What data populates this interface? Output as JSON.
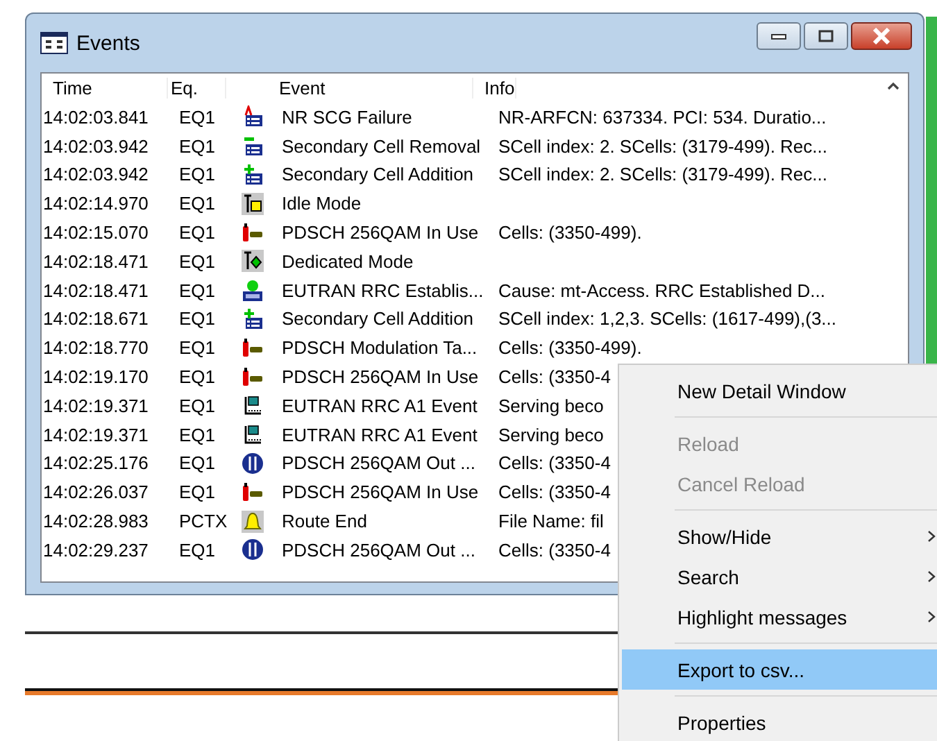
{
  "window": {
    "title": "Events"
  },
  "table": {
    "columns": [
      "Time",
      "Eq.",
      "",
      "Event",
      "Info"
    ],
    "rows": [
      {
        "time": "14:02:03.841",
        "eq": "EQ1",
        "kind": "failure",
        "event": "NR SCG Failure",
        "info": "NR-ARFCN: 637334.  PCI: 534.  Duratio..."
      },
      {
        "time": "14:02:03.942",
        "eq": "EQ1",
        "kind": "remove",
        "event": "Secondary Cell Removal",
        "info": "SCell index: 2.  SCells: (3179-499).  Rec..."
      },
      {
        "time": "14:02:03.942",
        "eq": "EQ1",
        "kind": "add",
        "event": "Secondary Cell Addition",
        "info": "SCell index: 2.  SCells: (3179-499).  Rec..."
      },
      {
        "time": "14:02:14.970",
        "eq": "EQ1",
        "kind": "idle",
        "event": "Idle Mode"
      },
      {
        "time": "14:02:15.070",
        "eq": "EQ1",
        "kind": "qam",
        "event": "PDSCH 256QAM In Use",
        "info": "Cells: (3350-499)."
      },
      {
        "time": "14:02:18.471",
        "eq": "EQ1",
        "kind": "dedicated",
        "event": "Dedicated Mode"
      },
      {
        "time": "14:02:18.471",
        "eq": "EQ1",
        "kind": "rrc",
        "event": "EUTRAN RRC Establis...",
        "info": "Cause: mt-Access.  RRC Established D..."
      },
      {
        "time": "14:02:18.671",
        "eq": "EQ1",
        "kind": "add",
        "event": "Secondary Cell Addition",
        "info": "SCell index: 1,2,3.  SCells: (1617-499),(3..."
      },
      {
        "time": "14:02:18.770",
        "eq": "EQ1",
        "kind": "qam",
        "event": "PDSCH Modulation Ta...",
        "info": "Cells: (3350-499)."
      },
      {
        "time": "14:02:19.170",
        "eq": "EQ1",
        "kind": "qam",
        "event": "PDSCH 256QAM In Use",
        "info": "Cells: (3350-4"
      },
      {
        "time": "14:02:19.371",
        "eq": "EQ1",
        "kind": "a1",
        "event": "EUTRAN RRC A1 Event",
        "info": "Serving beco"
      },
      {
        "time": "14:02:19.371",
        "eq": "EQ1",
        "kind": "a1",
        "event": "EUTRAN RRC A1 Event",
        "info": "Serving beco"
      },
      {
        "time": "14:02:25.176",
        "eq": "EQ1",
        "kind": "out",
        "event": "PDSCH 256QAM Out ...",
        "info": "Cells: (3350-4"
      },
      {
        "time": "14:02:26.037",
        "eq": "EQ1",
        "kind": "qam",
        "event": "PDSCH 256QAM In Use",
        "info": "Cells: (3350-4"
      },
      {
        "time": "14:02:28.983",
        "eq": "PCTX",
        "kind": "bell",
        "event": "Route End",
        "info": "File Name: fil"
      },
      {
        "time": "14:02:29.237",
        "eq": "EQ1",
        "kind": "out",
        "event": "PDSCH 256QAM Out ...",
        "info": "Cells: (3350-4"
      }
    ]
  },
  "context_menu": {
    "items": [
      {
        "kind": "item",
        "label": "New Detail Window",
        "disabled": false,
        "selected": false,
        "submenu": false
      },
      {
        "kind": "separator"
      },
      {
        "kind": "item",
        "label": "Reload",
        "disabled": true,
        "selected": false,
        "submenu": false
      },
      {
        "kind": "item",
        "label": "Cancel Reload",
        "disabled": true,
        "selected": false,
        "submenu": false
      },
      {
        "kind": "separator"
      },
      {
        "kind": "item",
        "label": "Show/Hide",
        "disabled": false,
        "selected": false,
        "submenu": true
      },
      {
        "kind": "item",
        "label": "Search",
        "disabled": false,
        "selected": false,
        "submenu": true
      },
      {
        "kind": "item",
        "label": "Highlight messages",
        "disabled": false,
        "selected": false,
        "submenu": true
      },
      {
        "kind": "separator"
      },
      {
        "kind": "item",
        "label": "Export to csv...",
        "disabled": false,
        "selected": true,
        "submenu": false
      },
      {
        "kind": "separator"
      },
      {
        "kind": "item",
        "label": "Properties",
        "disabled": false,
        "selected": false,
        "submenu": false
      }
    ]
  }
}
